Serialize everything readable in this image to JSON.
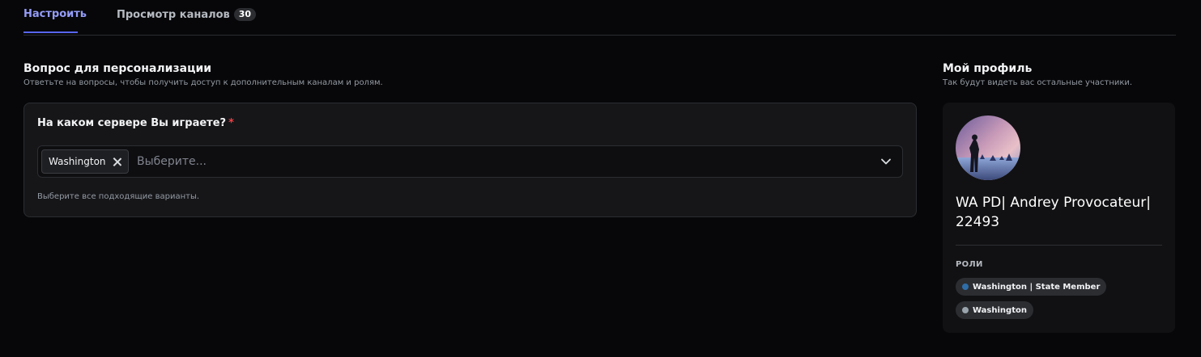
{
  "tabs": {
    "setup_label": "Настроить",
    "channels_label": "Просмотр каналов",
    "channels_count": "30"
  },
  "personalization": {
    "title": "Вопрос для персонализации",
    "subtitle": "Ответьте на вопросы, чтобы получить доступ к дополнительным каналам и ролям.",
    "question": {
      "text": "На каком сервере Вы играете?",
      "required_mark": "*",
      "selected": [
        "Washington"
      ],
      "placeholder": "Выберите...",
      "hint": "Выберите все подходящие варианты."
    }
  },
  "profile": {
    "title": "Мой профиль",
    "subtitle": "Так будут видеть вас остальные участники.",
    "display_name": "WA PD| Andrey Provocateur| 22493",
    "roles_label": "РОЛИ",
    "roles": [
      {
        "name": "Washington | State Member",
        "color": "#2f6da8"
      },
      {
        "name": "Washington",
        "color": "#9aa4ad"
      }
    ]
  },
  "colors": {
    "accent": "#5865f2",
    "required": "#f23f43"
  }
}
